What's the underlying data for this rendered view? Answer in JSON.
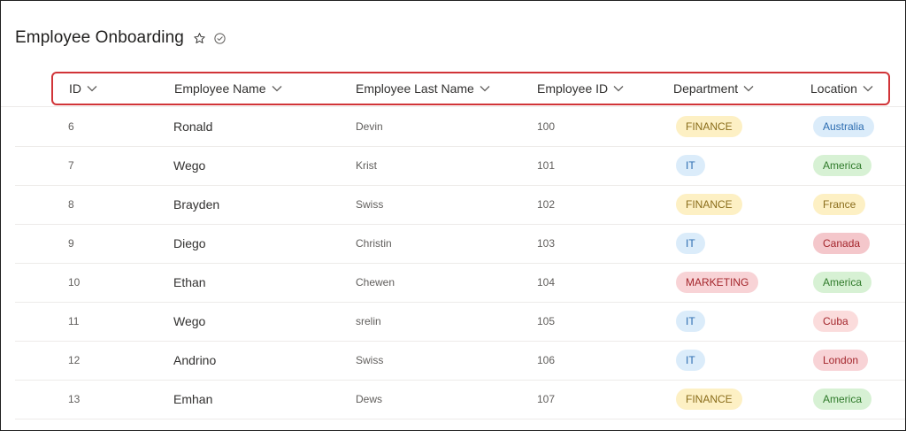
{
  "page": {
    "title": "Employee Onboarding",
    "icons": [
      "star-icon",
      "check-circle-icon"
    ]
  },
  "columns": [
    {
      "label": "ID"
    },
    {
      "label": "Employee Name"
    },
    {
      "label": "Employee Last Name"
    },
    {
      "label": "Employee ID"
    },
    {
      "label": "Department"
    },
    {
      "label": "Location"
    }
  ],
  "colors": {
    "FINANCE": {
      "bg": "#fdf0c4",
      "fg": "#8a6d1b"
    },
    "IT": {
      "bg": "#dbecfa",
      "fg": "#2b6cb0"
    },
    "MARKETING": {
      "bg": "#f8d3d6",
      "fg": "#a4262c"
    },
    "Australia": {
      "bg": "#dbecfa",
      "fg": "#2b6cb0"
    },
    "America": {
      "bg": "#d7f1d4",
      "fg": "#2f7a2a"
    },
    "France": {
      "bg": "#fdf0c4",
      "fg": "#8a6d1b"
    },
    "Canada": {
      "bg": "#f4c7cb",
      "fg": "#a4262c"
    },
    "Cuba": {
      "bg": "#fbdcdc",
      "fg": "#a4262c"
    },
    "London": {
      "bg": "#f8d3d6",
      "fg": "#a4262c"
    },
    "highlight": "#d13438"
  },
  "rows": [
    {
      "id": "6",
      "name": "Ronald",
      "last": "Devin",
      "empid": "100",
      "dept": "FINANCE",
      "loc": "Australia"
    },
    {
      "id": "7",
      "name": "Wego",
      "last": "Krist",
      "empid": "101",
      "dept": "IT",
      "loc": "America"
    },
    {
      "id": "8",
      "name": "Brayden",
      "last": "Swiss",
      "empid": "102",
      "dept": "FINANCE",
      "loc": "France"
    },
    {
      "id": "9",
      "name": "Diego",
      "last": "Christin",
      "empid": "103",
      "dept": "IT",
      "loc": "Canada"
    },
    {
      "id": "10",
      "name": "Ethan",
      "last": "Chewen",
      "empid": "104",
      "dept": "MARKETING",
      "loc": "America"
    },
    {
      "id": "11",
      "name": "Wego",
      "last": "srelin",
      "empid": "105",
      "dept": "IT",
      "loc": "Cuba"
    },
    {
      "id": "12",
      "name": "Andrino",
      "last": "Swiss",
      "empid": "106",
      "dept": "IT",
      "loc": "London"
    },
    {
      "id": "13",
      "name": "Emhan",
      "last": "Dews",
      "empid": "107",
      "dept": "FINANCE",
      "loc": "America"
    }
  ]
}
